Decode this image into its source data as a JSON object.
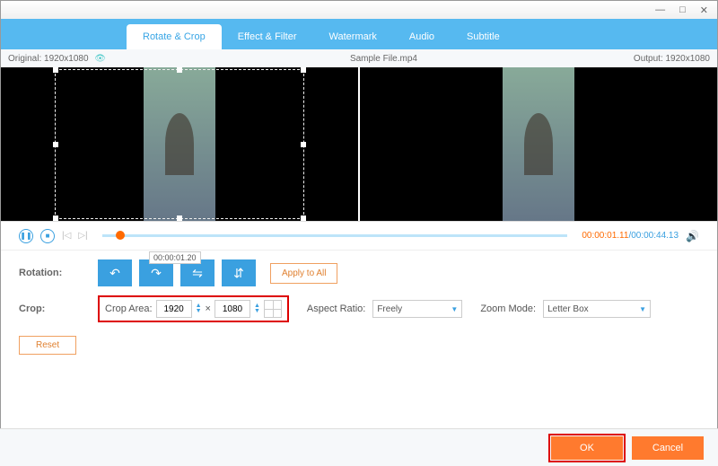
{
  "window": {
    "minimize": "—",
    "maximize": "□",
    "close": "✕"
  },
  "tabs": {
    "rotate_crop": "Rotate & Crop",
    "effect_filter": "Effect & Filter",
    "watermark": "Watermark",
    "audio": "Audio",
    "subtitle": "Subtitle"
  },
  "infobar": {
    "original_label": "Original:  1920x1080",
    "filename": "Sample File.mp4",
    "output_label": "Output:  1920x1080"
  },
  "playback": {
    "current": "00:00:01.11",
    "duration": "/00:00:44.13",
    "tooltip": "00:00:01.20"
  },
  "rotation": {
    "label": "Rotation:",
    "apply_all": "Apply to All"
  },
  "crop": {
    "label": "Crop:",
    "area_label": "Crop Area:",
    "width": "1920",
    "times": "×",
    "height": "1080",
    "aspect_label": "Aspect Ratio:",
    "aspect_value": "Freely",
    "zoom_label": "Zoom Mode:",
    "zoom_value": "Letter Box",
    "reset": "Reset"
  },
  "footer": {
    "ok": "OK",
    "cancel": "Cancel"
  }
}
